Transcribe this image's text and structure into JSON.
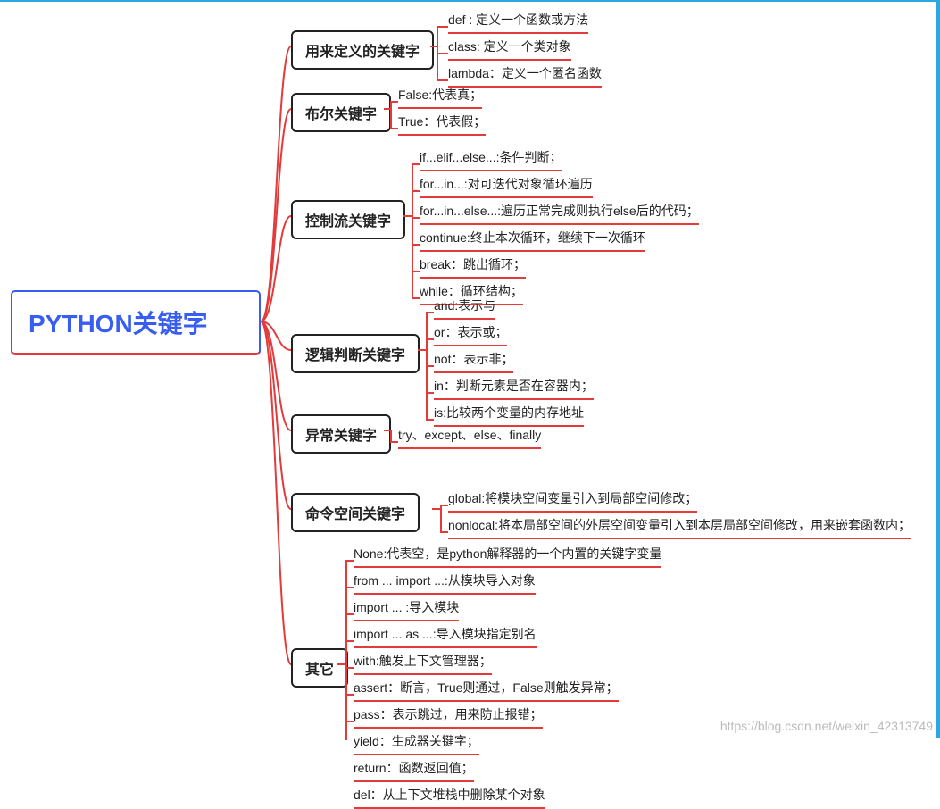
{
  "root": {
    "title": "PYTHON关键字"
  },
  "branches": [
    {
      "id": "b0",
      "label": "用来定义的关键字",
      "leaves": [
        {
          "text": "def : 定义一个函数或方法"
        },
        {
          "text": "class: 定义一个类对象"
        },
        {
          "text": "lambda：定义一个匿名函数"
        }
      ]
    },
    {
      "id": "b1",
      "label": "布尔关键字",
      "leaves": [
        {
          "text": "False:代表真；"
        },
        {
          "text": "True：代表假；"
        }
      ]
    },
    {
      "id": "b2",
      "label": "控制流关键字",
      "leaves": [
        {
          "text": "if...elif...else...:条件判断；"
        },
        {
          "text": "for...in...:对可迭代对象循环遍历"
        },
        {
          "text": "for...in...else...:遍历正常完成则执行else后的代码；"
        },
        {
          "text": "continue:终止本次循环，继续下一次循环"
        },
        {
          "text": "break：跳出循环；"
        },
        {
          "text": "while：循环结构；"
        }
      ]
    },
    {
      "id": "b3",
      "label": "逻辑判断关键字",
      "leaves": [
        {
          "text": "and:表示与"
        },
        {
          "text": "or：表示或；"
        },
        {
          "text": "not：表示非；"
        },
        {
          "text": "in：判断元素是否在容器内；"
        },
        {
          "text": "is:比较两个变量的内存地址"
        }
      ]
    },
    {
      "id": "b4",
      "label": "异常关键字",
      "leaves": [
        {
          "text": "try、except、else、finally"
        }
      ]
    },
    {
      "id": "b5",
      "label": "命令空间关键字",
      "leaves": [
        {
          "text": "global:将模块空间变量引入到局部空间修改；"
        },
        {
          "text": "nonlocal:将本局部空间的外层空间变量引入到本层局部空间修改，用来嵌套函数内；"
        }
      ]
    },
    {
      "id": "b6",
      "label": "其它",
      "leaves": [
        {
          "text": "None:代表空，是python解释器的一个内置的关键字变量"
        },
        {
          "text": "from ... import ...:从模块导入对象"
        },
        {
          "text": "import ... :导入模块"
        },
        {
          "text": "import ... as ...:导入模块指定别名"
        },
        {
          "text": "with:触发上下文管理器；"
        },
        {
          "text": "assert：断言，True则通过，False则触发异常；"
        },
        {
          "text": "pass：表示跳过，用来防止报错；"
        },
        {
          "text": "yield：生成器关键字；"
        },
        {
          "text": "return：函数返回值；"
        },
        {
          "text": "del：从上下文堆栈中删除某个对象"
        }
      ]
    }
  ],
  "watermark": "https://blog.csdn.net/weixin_42313749"
}
